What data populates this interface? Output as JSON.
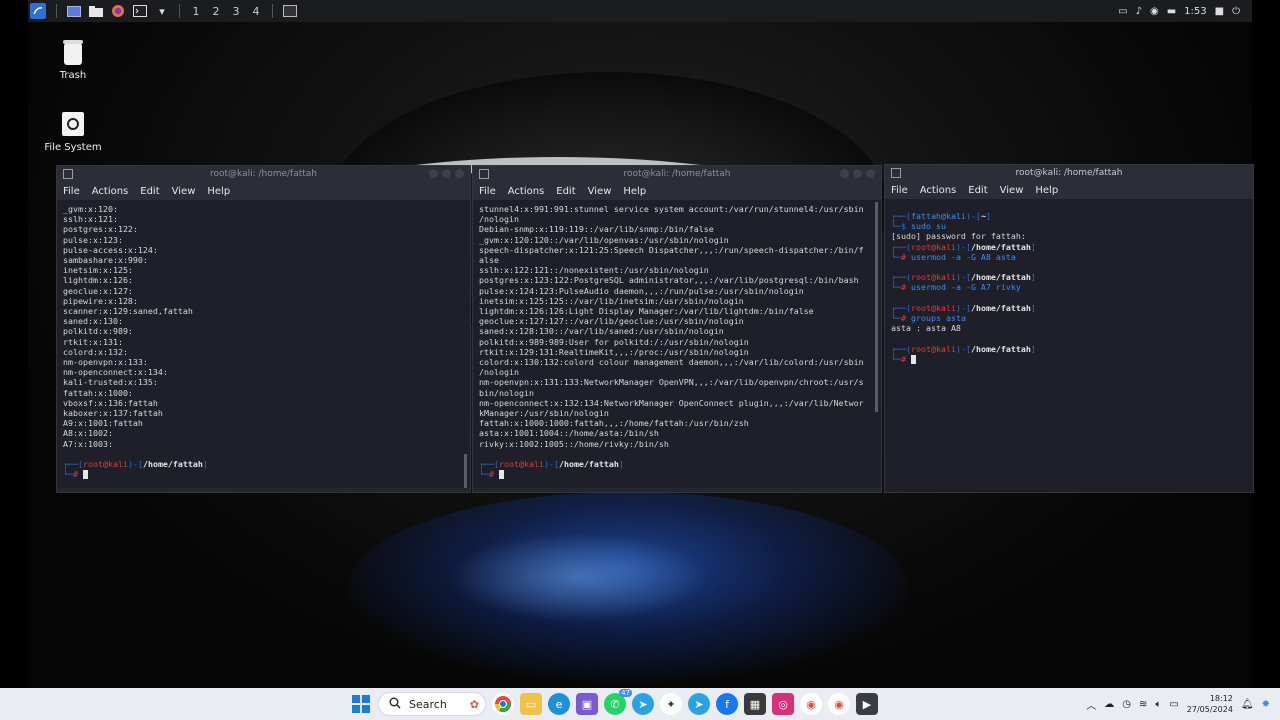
{
  "topbar": {
    "workspaces": [
      "1",
      "2",
      "3",
      "4"
    ],
    "clock": "1:53"
  },
  "desktop_icons": [
    {
      "label": "Trash",
      "icon": "trash-icon"
    },
    {
      "label": "File System",
      "icon": "file-system-icon"
    }
  ],
  "windows": [
    {
      "title": "root@kali: /home/fattah",
      "menu": [
        "File",
        "Actions",
        "Edit",
        "View",
        "Help"
      ]
    },
    {
      "title": "root@kali: /home/fattah",
      "menu": [
        "File",
        "Actions",
        "Edit",
        "View",
        "Help"
      ]
    },
    {
      "title": "root@kali: /home/fattah",
      "menu": [
        "File",
        "Actions",
        "Edit",
        "View",
        "Help"
      ]
    }
  ],
  "term1": {
    "lines": [
      "_gvm:x:120:",
      "sslh:x:121:",
      "postgres:x:122:",
      "pulse:x:123:",
      "pulse-access:x:124:",
      "sambashare:x:990:",
      "inetsim:x:125:",
      "lightdm:x:126:",
      "geoclue:x:127:",
      "pipewire:x:128:",
      "scanner:x:129:saned,fattah",
      "saned:x:130:",
      "polkitd:x:989:",
      "rtkit:x:131:",
      "colord:x:132:",
      "nm-openvpn:x:133:",
      "nm-openconnect:x:134:",
      "kali-trusted:x:135:",
      "fattah:x:1000:",
      "vboxsf:x:136:fattah",
      "kaboxer:x:137:fattah",
      "A9:x:1001:fattah",
      "A8:x:1002:",
      "A7:x:1003:"
    ],
    "prompt_user": "root@kali",
    "prompt_path": "/home/fattah"
  },
  "term2": {
    "lines": [
      "stunnel4:x:991:991:stunnel service system account:/var/run/stunnel4:/usr/sbin",
      "/nologin",
      "Debian-snmp:x:119:119::/var/lib/snmp:/bin/false",
      "_gvm:x:120:120::/var/lib/openvas:/usr/sbin/nologin",
      "speech-dispatcher:x:121:25:Speech Dispatcher,,,:/run/speech-dispatcher:/bin/f",
      "alse",
      "sslh:x:122:121::/nonexistent:/usr/sbin/nologin",
      "postgres:x:123:122:PostgreSQL administrator,,,:/var/lib/postgresql:/bin/bash",
      "pulse:x:124:123:PulseAudio daemon,,,:/run/pulse:/usr/sbin/nologin",
      "inetsim:x:125:125::/var/lib/inetsim:/usr/sbin/nologin",
      "lightdm:x:126:126:Light Display Manager:/var/lib/lightdm:/bin/false",
      "geoclue:x:127:127::/var/lib/geoclue:/usr/sbin/nologin",
      "saned:x:128:130::/var/lib/saned:/usr/sbin/nologin",
      "polkitd:x:989:989:User for polkitd:/:/usr/sbin/nologin",
      "rtkit:x:129:131:RealtimeKit,,,:/proc:/usr/sbin/nologin",
      "colord:x:130:132:colord colour management daemon,,,:/var/lib/colord:/usr/sbin",
      "/nologin",
      "nm-openvpn:x:131:133:NetworkManager OpenVPN,,,:/var/lib/openvpn/chroot:/usr/s",
      "bin/nologin",
      "nm-openconnect:x:132:134:NetworkManager OpenConnect plugin,,,:/var/lib/Networ",
      "kManager:/usr/sbin/nologin",
      "fattah:x:1000:1000:fattah,,,:/home/fattah:/usr/bin/zsh",
      "asta:x:1001:1004::/home/asta:/bin/sh",
      "rivky:x:1002:1005::/home/rivky:/bin/sh"
    ],
    "prompt_user": "root@kali",
    "prompt_path": "/home/fattah"
  },
  "term3": {
    "prompt1_user": "fattah@kali",
    "prompt1_path": "~",
    "cmd1": "sudo su",
    "out1": "[sudo] password for fattah:",
    "root_user": "root@kali",
    "root_path": "/home/fattah",
    "cmd2": "usermod -a -G A8 asta",
    "cmd3": "usermod -a -G A7 rivky",
    "cmd4": "groups asta",
    "out4": "asta : asta A8"
  },
  "taskbar": {
    "search_label": "Search",
    "badge": "47",
    "time": "18:12",
    "date": "27/05/2024"
  },
  "colors": {
    "terminal_bg": "#1e1f29",
    "prompt_blue": "#3a8cf2",
    "prompt_red": "#e23a3a",
    "taskbar_bg": "#e9ecf2"
  }
}
